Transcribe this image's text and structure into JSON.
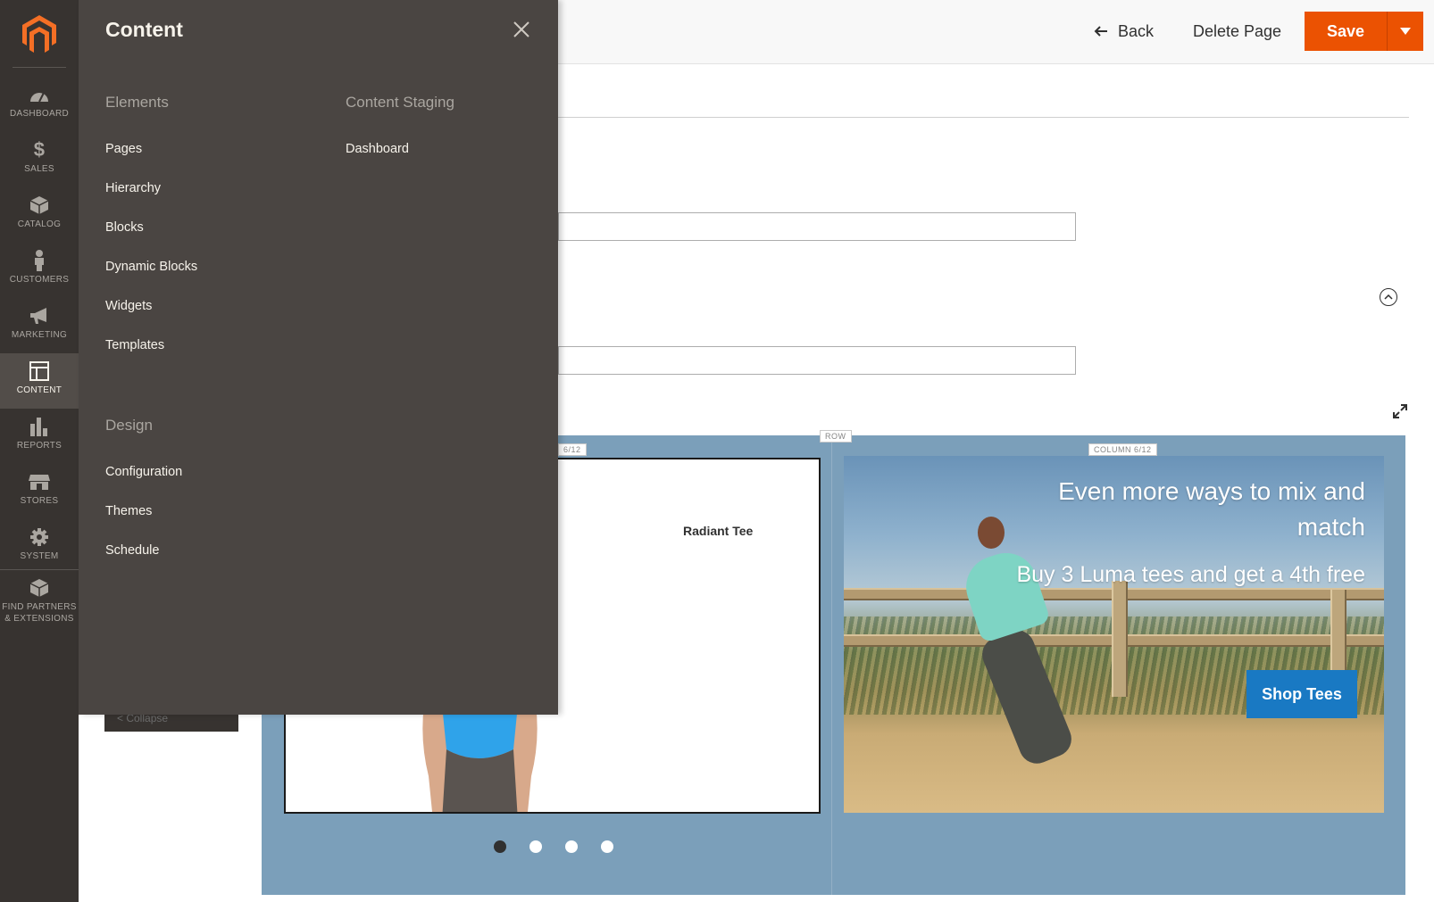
{
  "header": {
    "back_label": "Back",
    "delete_label": "Delete Page",
    "save_label": "Save"
  },
  "sidebar": {
    "items": [
      {
        "label": "DASHBOARD",
        "icon": "dashboard-icon"
      },
      {
        "label": "SALES",
        "icon": "dollar-icon"
      },
      {
        "label": "CATALOG",
        "icon": "box-icon"
      },
      {
        "label": "CUSTOMERS",
        "icon": "person-icon"
      },
      {
        "label": "MARKETING",
        "icon": "megaphone-icon"
      },
      {
        "label": "CONTENT",
        "icon": "layout-icon",
        "active": true
      },
      {
        "label": "REPORTS",
        "icon": "bar-chart-icon"
      },
      {
        "label": "STORES",
        "icon": "storefront-icon"
      },
      {
        "label": "SYSTEM",
        "icon": "gear-icon"
      },
      {
        "label": "FIND PARTNERS & EXTENSIONS",
        "icon": "cube-icon"
      }
    ]
  },
  "flyout": {
    "title": "Content",
    "sections": [
      {
        "title": "Elements",
        "links": [
          "Pages",
          "Hierarchy",
          "Blocks",
          "Dynamic Blocks",
          "Widgets",
          "Templates"
        ]
      },
      {
        "title": "Content Staging",
        "links": [
          "Dashboard"
        ]
      },
      {
        "title": "Design",
        "links": [
          "Configuration",
          "Themes",
          "Schedule"
        ]
      }
    ]
  },
  "stage": {
    "row_label": "ROW",
    "column_label_left": "6/12",
    "column_label_right": "COLUMN 6/12",
    "product_name": "Radiant Tee",
    "banner_title": "Even more ways to mix and match",
    "banner_subtitle": "Buy 3 Luma tees and get a 4th free",
    "banner_button": "Shop Tees",
    "slider_dots": 4,
    "active_dot": 0
  },
  "collapse_label": "< Collapse",
  "colors": {
    "accent": "#eb5202",
    "sidebar_bg": "#373330",
    "flyout_bg": "#4a4542",
    "stage_bg": "#7b9fba",
    "button_blue": "#1979c3"
  }
}
